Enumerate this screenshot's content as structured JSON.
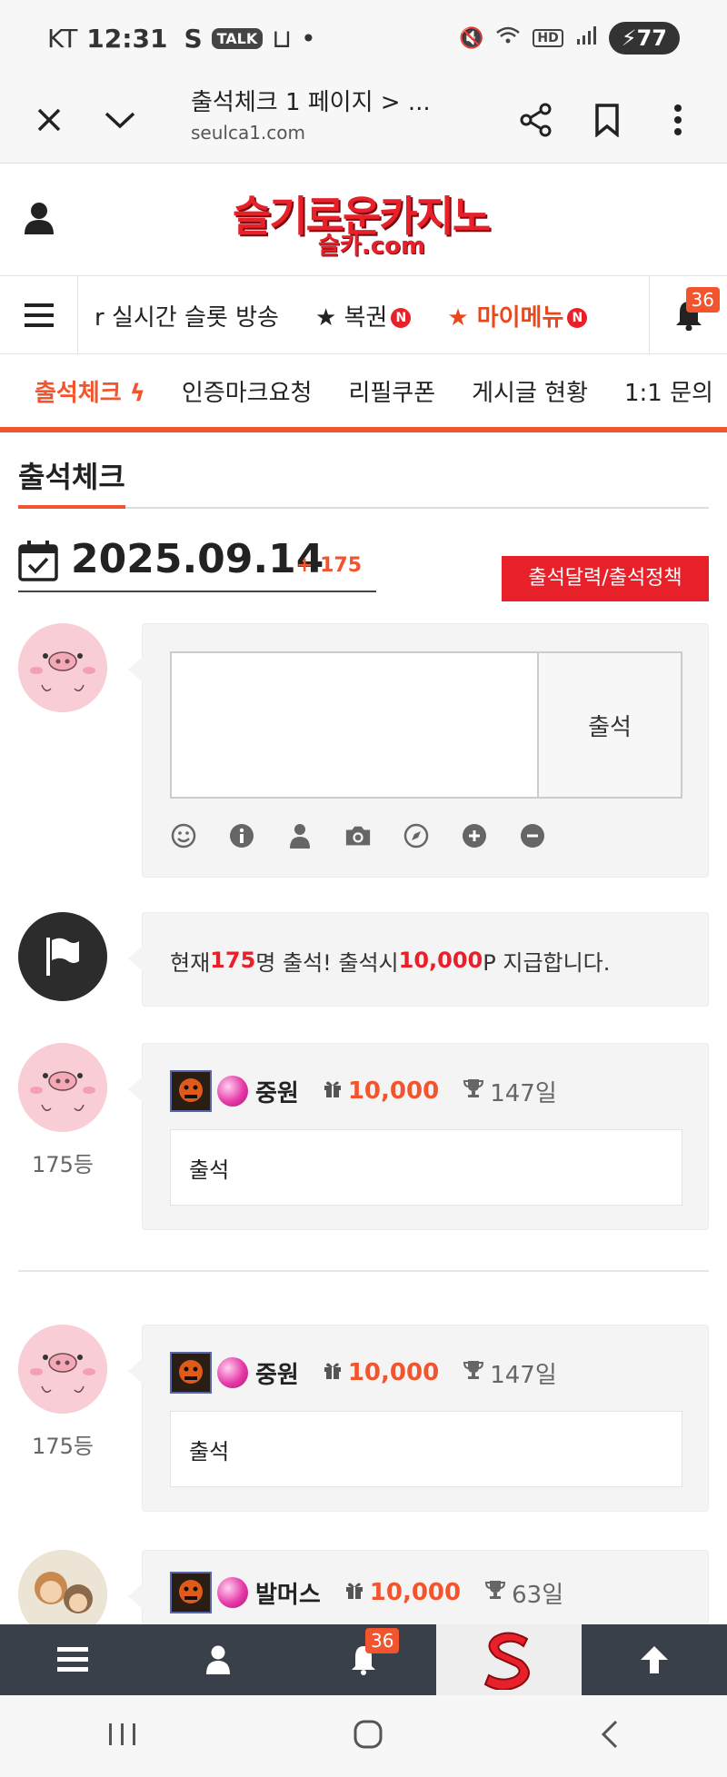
{
  "status_bar": {
    "carrier": "KT",
    "time": "12:31",
    "talk_badge": "TALK",
    "battery": "77"
  },
  "browser": {
    "title": "출석체크 1 페이지 > ...",
    "url": "seulca1.com"
  },
  "site": {
    "logo_main": "슬기로운카지노",
    "logo_sub": "슬카.com"
  },
  "nav_main": {
    "items": [
      "r 실시간 슬롯 방송",
      "★ 복권",
      "★ 마이메뉴"
    ],
    "new_badge": "N",
    "notification_count": "36"
  },
  "nav_sub": {
    "items": [
      "출석체크",
      "인증마크요청",
      "리필쿠폰",
      "게시글 현황",
      "1:1 문의"
    ]
  },
  "page": {
    "title": "출석체크",
    "date": "2025.09.14",
    "count_plus": "+ 175",
    "policy_button": "출석달력/출석정책"
  },
  "write": {
    "submit_label": "출석",
    "toolbar_icons": [
      "smile-icon",
      "info-icon",
      "user-icon",
      "camera-icon",
      "compass-icon",
      "plus-circle-icon",
      "minus-circle-icon"
    ]
  },
  "notice": {
    "prefix": "현재 ",
    "count": "175",
    "middle": "명 출석! 출석시 ",
    "amount": "10,000",
    "suffix": "P 지급합니다."
  },
  "entries": [
    {
      "rank": "175등",
      "name": "중원",
      "points": "10,000",
      "days": "147일",
      "message": "출석"
    },
    {
      "rank": "175등",
      "name": "중원",
      "points": "10,000",
      "days": "147일",
      "message": "출석"
    },
    {
      "rank": "",
      "name": "발머스",
      "points": "10,000",
      "days": "63일",
      "message": ""
    }
  ],
  "bottom_nav": {
    "notification_count": "36"
  },
  "colors": {
    "accent": "#f2542d",
    "brand_red": "#e8202a",
    "bottom_bar": "#3a4049"
  }
}
